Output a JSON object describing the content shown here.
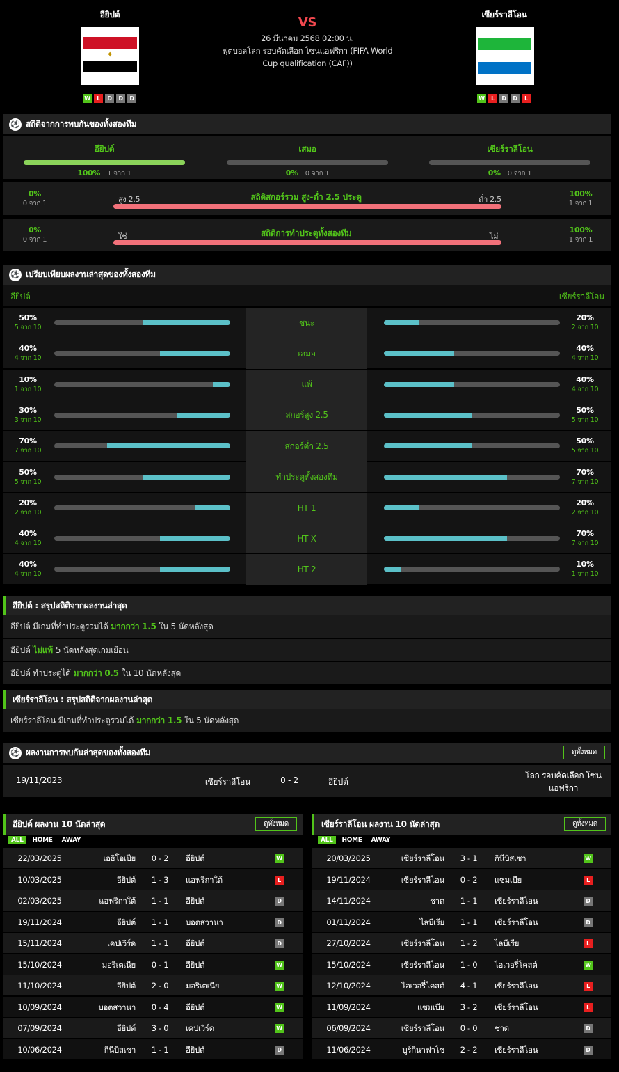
{
  "header": {
    "home": {
      "name": "อียิปต์",
      "form": [
        "W",
        "L",
        "D",
        "D",
        "D"
      ]
    },
    "away": {
      "name": "เซียร์ราลีโอน",
      "form": [
        "W",
        "L",
        "D",
        "D",
        "L"
      ]
    },
    "vs": "VS",
    "date": "26 มีนาคม 2568 02:00 น.",
    "competition": "ฟุตบอลโลก รอบคัดเลือก โซนแอฟริกา (FIFA World Cup qualification (CAF))"
  },
  "h2h": {
    "title": "สถิติจากการพบกันของทั้งสองทีม",
    "cols": [
      {
        "name": "อียิปต์",
        "pct": "100%",
        "sub": "1 จาก 1",
        "fill": 1
      },
      {
        "name": "เสมอ",
        "pct": "0%",
        "sub": "0 จาก 1",
        "fill": 0
      },
      {
        "name": "เซียร์ราลีโอน",
        "pct": "0%",
        "sub": "0 จาก 1",
        "fill": 0
      }
    ],
    "ou": {
      "left_pct": "0%",
      "left_sub": "0 จาก 1",
      "left_label": "สูง 2.5",
      "title": "สถิติสกอร์รวม สูง-ต่ำ 2.5 ประตู",
      "right_label": "ต่ำ 2.5",
      "right_pct": "100%",
      "right_sub": "1 จาก 1"
    },
    "btts": {
      "left_pct": "0%",
      "left_sub": "0 จาก 1",
      "left_label": "ใช่",
      "title": "สถิติการทำประตูทั้งสองทีม",
      "right_label": "ไม่",
      "right_pct": "100%",
      "right_sub": "1 จาก 1"
    }
  },
  "compare": {
    "title": "เปรียบเทียบผลงานล่าสุดของทั้งสองทีม",
    "home": "อียิปต์",
    "away": "เซียร์ราลีโอน",
    "rows": [
      {
        "label": "ชนะ",
        "l": "50%",
        "ls": "5 จาก 10",
        "lf": 0.5,
        "r": "20%",
        "rs": "2 จาก 10",
        "rf": 0.2
      },
      {
        "label": "เสมอ",
        "l": "40%",
        "ls": "4 จาก 10",
        "lf": 0.4,
        "r": "40%",
        "rs": "4 จาก 10",
        "rf": 0.4
      },
      {
        "label": "แพ้",
        "l": "10%",
        "ls": "1 จาก 10",
        "lf": 0.1,
        "r": "40%",
        "rs": "4 จาก 10",
        "rf": 0.4
      },
      {
        "label": "สกอร์สูง 2.5",
        "l": "30%",
        "ls": "3 จาก 10",
        "lf": 0.3,
        "r": "50%",
        "rs": "5 จาก 10",
        "rf": 0.5
      },
      {
        "label": "สกอร์ต่ำ 2.5",
        "l": "70%",
        "ls": "7 จาก 10",
        "lf": 0.7,
        "r": "50%",
        "rs": "5 จาก 10",
        "rf": 0.5
      },
      {
        "label": "ทำประตูทั้งสองทีม",
        "l": "50%",
        "ls": "5 จาก 10",
        "lf": 0.5,
        "r": "70%",
        "rs": "7 จาก 10",
        "rf": 0.7
      },
      {
        "label": "HT 1",
        "l": "20%",
        "ls": "2 จาก 10",
        "lf": 0.2,
        "r": "20%",
        "rs": "2 จาก 10",
        "rf": 0.2
      },
      {
        "label": "HT X",
        "l": "40%",
        "ls": "4 จาก 10",
        "lf": 0.4,
        "r": "70%",
        "rs": "7 จาก 10",
        "rf": 0.7
      },
      {
        "label": "HT 2",
        "l": "40%",
        "ls": "4 จาก 10",
        "lf": 0.4,
        "r": "10%",
        "rs": "1 จาก 10",
        "rf": 0.1
      }
    ]
  },
  "summary_home": {
    "title": "อียิปต์ : สรุปสถิติจากผลงานล่าสุด",
    "lines": [
      {
        "a": "อียิปต์  มีเกมที่ทำประตูรวมได้",
        "b": "มากกว่า  1.5",
        "c": "ใน 5 นัดหลังสุด"
      },
      {
        "a": "อียิปต์",
        "b": "ไม่แพ้",
        "c": "5  นัดหลังสุดเกมเยือน"
      },
      {
        "a": "อียิปต์  ทำประตูได้",
        "b": "มากกว่า  0.5",
        "c": "ใน 10 นัดหลังสุด"
      }
    ]
  },
  "summary_away": {
    "title": "เซียร์ราลีโอน : สรุปสถิติจากผลงานล่าสุด",
    "lines": [
      {
        "a": "เซียร์ราลีโอน  มีเกมที่ทำประตูรวมได้",
        "b": "มากกว่า  1.5",
        "c": "ใน 5 นัดหลังสุด"
      }
    ]
  },
  "recent_h2h": {
    "title": "ผลงานการพบกันล่าสุดของทั้งสองทีม",
    "view_all": "ดูทั้งหมด",
    "date": "19/11/2023",
    "home": "เซียร์ราลีโอน",
    "score": "0 - 2",
    "away": "อียิปต์",
    "comp": "โลก รอบคัดเลือก โซนแอฟริกา"
  },
  "last10_home": {
    "title": "อียิปต์ ผลงาน 10 นัดล่าสุด",
    "view_all": "ดูทั้งหมด",
    "tabs": [
      "ALL",
      "HOME",
      "AWAY"
    ],
    "matches": [
      {
        "d": "22/03/2025",
        "h": "เอธิโอเปีย",
        "s": "0 - 2",
        "a": "อียิปต์",
        "r": "W"
      },
      {
        "d": "10/03/2025",
        "h": "อียิปต์",
        "s": "1 - 3",
        "a": "แอฟริกาใต้",
        "r": "L"
      },
      {
        "d": "02/03/2025",
        "h": "แอฟริกาใต้",
        "s": "1 - 1",
        "a": "อียิปต์",
        "r": "D"
      },
      {
        "d": "19/11/2024",
        "h": "อียิปต์",
        "s": "1 - 1",
        "a": "บอตสวานา",
        "r": "D"
      },
      {
        "d": "15/11/2024",
        "h": "เคปเวิร์ด",
        "s": "1 - 1",
        "a": "อียิปต์",
        "r": "D"
      },
      {
        "d": "15/10/2024",
        "h": "มอริเตเนีย",
        "s": "0 - 1",
        "a": "อียิปต์",
        "r": "W"
      },
      {
        "d": "11/10/2024",
        "h": "อียิปต์",
        "s": "2 - 0",
        "a": "มอริเตเนีย",
        "r": "W"
      },
      {
        "d": "10/09/2024",
        "h": "บอตสวานา",
        "s": "0 - 4",
        "a": "อียิปต์",
        "r": "W"
      },
      {
        "d": "07/09/2024",
        "h": "อียิปต์",
        "s": "3 - 0",
        "a": "เคปเวิร์ด",
        "r": "W"
      },
      {
        "d": "10/06/2024",
        "h": "กินีบิสเซา",
        "s": "1 - 1",
        "a": "อียิปต์",
        "r": "D"
      }
    ]
  },
  "last10_away": {
    "title": "เซียร์ราลีโอน ผลงาน 10 นัดล่าสุด",
    "view_all": "ดูทั้งหมด",
    "tabs": [
      "ALL",
      "HOME",
      "AWAY"
    ],
    "matches": [
      {
        "d": "20/03/2025",
        "h": "เซียร์ราลีโอน",
        "s": "3 - 1",
        "a": "กินีบิสเซา",
        "r": "W"
      },
      {
        "d": "19/11/2024",
        "h": "เซียร์ราลีโอน",
        "s": "0 - 2",
        "a": "แซมเบีย",
        "r": "L"
      },
      {
        "d": "14/11/2024",
        "h": "ชาด",
        "s": "1 - 1",
        "a": "เซียร์ราลีโอน",
        "r": "D"
      },
      {
        "d": "01/11/2024",
        "h": "ไลบีเรีย",
        "s": "1 - 1",
        "a": "เซียร์ราลีโอน",
        "r": "D"
      },
      {
        "d": "27/10/2024",
        "h": "เซียร์ราลีโอน",
        "s": "1 - 2",
        "a": "ไลบีเรีย",
        "r": "L"
      },
      {
        "d": "15/10/2024",
        "h": "เซียร์ราลีโอน",
        "s": "1 - 0",
        "a": "ไอเวอรี่โคสต์",
        "r": "W"
      },
      {
        "d": "12/10/2024",
        "h": "ไอเวอรี่โคสต์",
        "s": "4 - 1",
        "a": "เซียร์ราลีโอน",
        "r": "L"
      },
      {
        "d": "11/09/2024",
        "h": "แซมเบีย",
        "s": "3 - 2",
        "a": "เซียร์ราลีโอน",
        "r": "L"
      },
      {
        "d": "06/09/2024",
        "h": "เซียร์ราลีโอน",
        "s": "0 - 0",
        "a": "ชาด",
        "r": "D"
      },
      {
        "d": "11/06/2024",
        "h": "บูร์กินาฟาโซ",
        "s": "2 - 2",
        "a": "เซียร์ราลีโอน",
        "r": "D"
      }
    ]
  },
  "colors": {
    "accent": "#52c41a",
    "bar_teal": "#5bc0c8",
    "bar_red": "#f2717a",
    "vs": "#f2484f"
  },
  "icons": {
    "section": "soccer-ball-icon"
  }
}
